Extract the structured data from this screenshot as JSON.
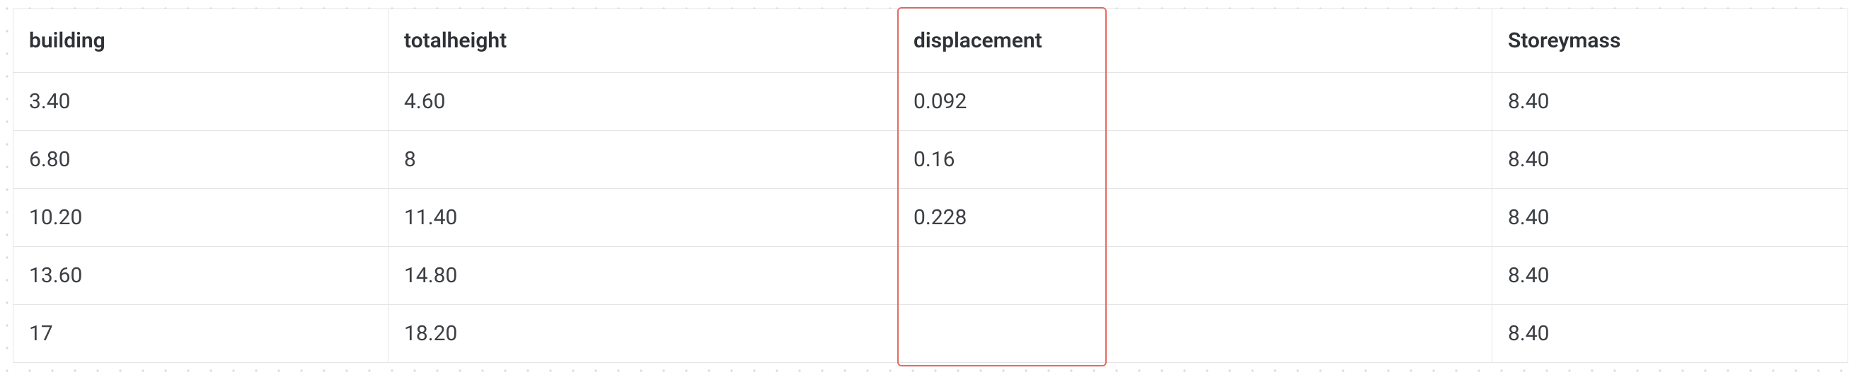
{
  "table": {
    "headers": {
      "building": "building",
      "totalheight": "totalheight",
      "displacement": "displacement",
      "storeymass": "Storeymass"
    },
    "rows": [
      {
        "building": "3.40",
        "totalheight": "4.60",
        "displacement": "0.092",
        "storeymass": "8.40"
      },
      {
        "building": "6.80",
        "totalheight": "8",
        "displacement": "0.16",
        "storeymass": "8.40"
      },
      {
        "building": "10.20",
        "totalheight": "11.40",
        "displacement": "0.228",
        "storeymass": "8.40"
      },
      {
        "building": "13.60",
        "totalheight": "14.80",
        "displacement": "",
        "storeymass": "8.40"
      },
      {
        "building": "17",
        "totalheight": "18.20",
        "displacement": "",
        "storeymass": "8.40"
      }
    ]
  },
  "highlight": {
    "column": "displacement"
  }
}
